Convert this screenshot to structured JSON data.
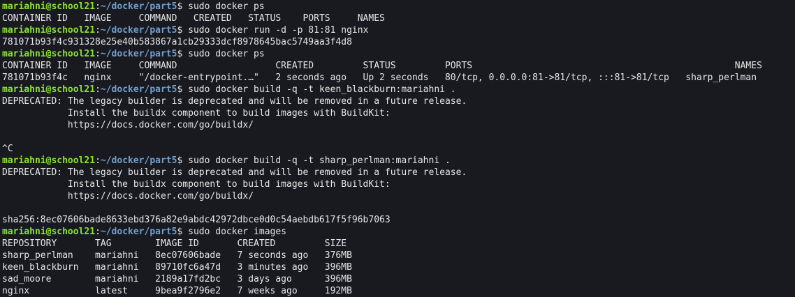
{
  "colors": {
    "background": "#181a1f",
    "text": "#e6e6e6",
    "prompt_user": "#8ae234",
    "prompt_path": "#729fcf"
  },
  "lines": [
    {
      "kind": "prompt",
      "user": "mariahni@school21",
      "sep": ":",
      "path": "~/docker/part5",
      "sym": "$ ",
      "cmd": "sudo docker ps"
    },
    {
      "kind": "output",
      "text": "CONTAINER ID   IMAGE     COMMAND   CREATED   STATUS    PORTS     NAMES"
    },
    {
      "kind": "prompt",
      "user": "mariahni@school21",
      "sep": ":",
      "path": "~/docker/part5",
      "sym": "$ ",
      "cmd": "sudo docker run -d -p 81:81 nginx"
    },
    {
      "kind": "output",
      "text": "781071b93f4c931328e25e40b583867a1cb29333dcf8978645bac5749aa3f4d8"
    },
    {
      "kind": "prompt",
      "user": "mariahni@school21",
      "sep": ":",
      "path": "~/docker/part5",
      "sym": "$ ",
      "cmd": "sudo docker ps"
    },
    {
      "kind": "output",
      "text": "CONTAINER ID   IMAGE     COMMAND                  CREATED         STATUS         PORTS                                                NAMES"
    },
    {
      "kind": "output",
      "text": "781071b93f4c   nginx     \"/docker-entrypoint.…\"   2 seconds ago   Up 2 seconds   80/tcp, 0.0.0.0:81->81/tcp, :::81->81/tcp   sharp_perlman"
    },
    {
      "kind": "prompt",
      "user": "mariahni@school21",
      "sep": ":",
      "path": "~/docker/part5",
      "sym": "$ ",
      "cmd": "sudo docker build -q -t keen_blackburn:mariahni ."
    },
    {
      "kind": "output",
      "text": "DEPRECATED: The legacy builder is deprecated and will be removed in a future release."
    },
    {
      "kind": "output",
      "text": "            Install the buildx component to build images with BuildKit:"
    },
    {
      "kind": "output",
      "text": "            https://docs.docker.com/go/buildx/"
    },
    {
      "kind": "output",
      "text": ""
    },
    {
      "kind": "output",
      "text": "^C"
    },
    {
      "kind": "prompt",
      "user": "mariahni@school21",
      "sep": ":",
      "path": "~/docker/part5",
      "sym": "$ ",
      "cmd": "sudo docker build -q -t sharp_perlman:mariahni ."
    },
    {
      "kind": "output",
      "text": "DEPRECATED: The legacy builder is deprecated and will be removed in a future release."
    },
    {
      "kind": "output",
      "text": "            Install the buildx component to build images with BuildKit:"
    },
    {
      "kind": "output",
      "text": "            https://docs.docker.com/go/buildx/"
    },
    {
      "kind": "output",
      "text": ""
    },
    {
      "kind": "output",
      "text": "sha256:8ec07606bade8633ebd376a82e9abdc42972dbce0d0c54aebdb617f5f96b7063"
    },
    {
      "kind": "prompt",
      "user": "mariahni@school21",
      "sep": ":",
      "path": "~/docker/part5",
      "sym": "$ ",
      "cmd": "sudo docker images"
    },
    {
      "kind": "output",
      "text": "REPOSITORY       TAG        IMAGE ID       CREATED         SIZE"
    },
    {
      "kind": "output",
      "text": "sharp_perlman    mariahni   8ec07606bade   7 seconds ago   376MB"
    },
    {
      "kind": "output",
      "text": "keen_blackburn   mariahni   89710fc6a47d   3 minutes ago   396MB"
    },
    {
      "kind": "output",
      "text": "sad_moore        mariahni   2189a17fd2bc   3 days ago      396MB"
    },
    {
      "kind": "output",
      "text": "nginx            latest     9bea9f2796e2   7 weeks ago     192MB"
    }
  ]
}
